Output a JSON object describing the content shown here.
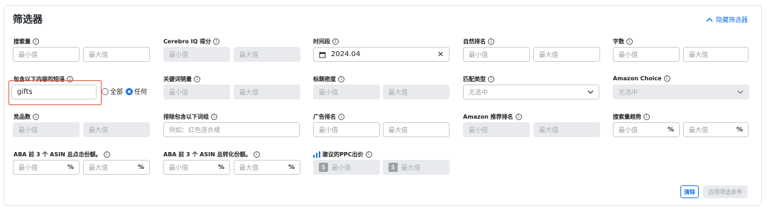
{
  "title": "筛选器",
  "hide_filters": "隐藏筛选器",
  "placeholders": {
    "min": "最小值",
    "max": "最大值",
    "example": "例如：红色连衣裙",
    "unselected": "无选中"
  },
  "labels": {
    "search_volume": "搜索量",
    "cerebro_iq": "Cerebro IQ 得分",
    "time_range": "时间段",
    "organic_rank": "自然排名",
    "word_count": "字数",
    "contains_phrase": "包含以下内容的短语",
    "keyword_sales": "关键词销量",
    "title_density": "标题密度",
    "match_type": "匹配类型",
    "amazon_choice": "Amazon Choice",
    "competing_products": "竞品数",
    "exclude_phrases": "排除包含以下词组",
    "ad_rank": "广告排名",
    "amazon_recommended_rank": "Amazon 推荐排名",
    "search_trend": "搜索量趋势",
    "aba_click_share": "ABA 前 3 个 ASIN 总点击份额。",
    "aba_conversion_share": "ABA 前 3 个 ASIN 总转化份额。",
    "ppc_bid": "建议的PPC出价"
  },
  "values": {
    "time_range": "2024.04",
    "contains_phrase": "gifts",
    "match_type": "无选中",
    "amazon_choice": "无选中"
  },
  "radio": {
    "all": "全部",
    "any": "任何",
    "selected": "any"
  },
  "units": {
    "percent": "%",
    "dollar": "$"
  },
  "buttons": {
    "clear": "清除",
    "apply": "应用筛选条件"
  },
  "colors": {
    "accent": "#1a73e8",
    "highlight": "#e5533c"
  }
}
